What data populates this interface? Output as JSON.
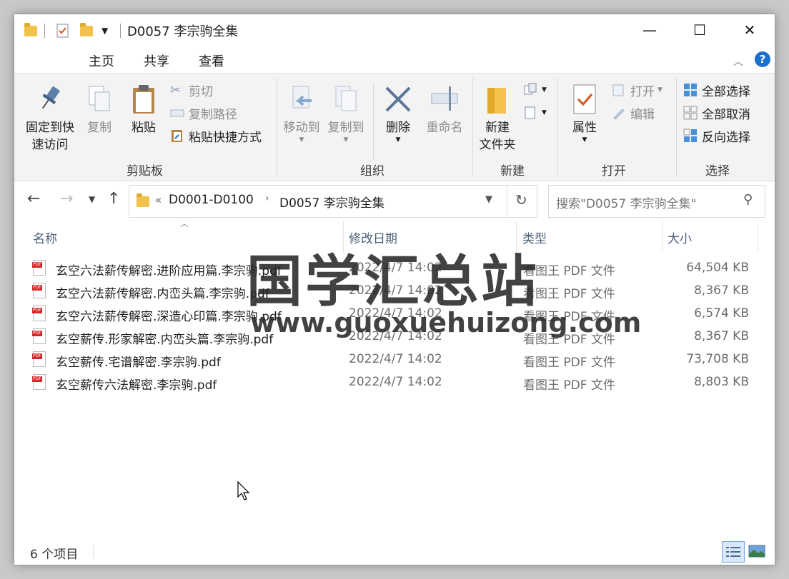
{
  "window": {
    "title": "D0057 李宗驹全集",
    "controls": {
      "minimize": "—",
      "maximize": "☐",
      "close": "✕"
    }
  },
  "tabs": [
    "主页",
    "共享",
    "查看"
  ],
  "ribbon": {
    "clipboard": {
      "pin_label_1": "固定到快",
      "pin_label_2": "速访问",
      "copy": "复制",
      "paste": "粘贴",
      "cut": "剪切",
      "copy_path": "复制路径",
      "paste_shortcut": "粘贴快捷方式",
      "group": "剪贴板"
    },
    "organize": {
      "move_to": "移动到",
      "copy_to": "复制到",
      "delete": "删除",
      "rename": "重命名",
      "group": "组织"
    },
    "new": {
      "new_folder_1": "新建",
      "new_folder_2": "文件夹",
      "group": "新建"
    },
    "open": {
      "properties": "属性",
      "open": "打开",
      "edit": "编辑",
      "group": "打开"
    },
    "select": {
      "select_all": "全部选择",
      "select_none": "全部取消",
      "invert": "反向选择",
      "group": "选择"
    }
  },
  "address": {
    "crumb_prefix": "«",
    "crumb1": "D0001-D0100",
    "crumb2": "D0057 李宗驹全集",
    "search_placeholder": "搜索\"D0057 李宗驹全集\""
  },
  "columns": {
    "name": "名称",
    "date": "修改日期",
    "type": "类型",
    "size": "大小"
  },
  "files": [
    {
      "name": "玄空六法薪传解密.进阶应用篇.李宗驹.pdf",
      "date": "2022/4/7 14:02",
      "type": "看图王 PDF 文件",
      "size": "64,504 KB"
    },
    {
      "name": "玄空六法薪传解密.内峦头篇.李宗驹.pdf",
      "date": "2022/4/7 14:02",
      "type": "看图王 PDF 文件",
      "size": "8,367 KB"
    },
    {
      "name": "玄空六法薪传解密.深造心印篇.李宗驹.pdf",
      "date": "2022/4/7 14:02",
      "type": "看图王 PDF 文件",
      "size": "6,574 KB"
    },
    {
      "name": "玄空薪传.形家解密.内峦头篇.李宗驹.pdf",
      "date": "2022/4/7 14:02",
      "type": "看图王 PDF 文件",
      "size": "8,367 KB"
    },
    {
      "name": "玄空薪传.宅谱解密.李宗驹.pdf",
      "date": "2022/4/7 14:02",
      "type": "看图王 PDF 文件",
      "size": "73,708 KB"
    },
    {
      "name": "玄空薪传六法解密.李宗驹.pdf",
      "date": "2022/4/7 14:02",
      "type": "看图王 PDF 文件",
      "size": "8,803 KB"
    }
  ],
  "watermark": {
    "line1": "国学汇总站",
    "line2": "www.guoxuehuizong.com"
  },
  "status": {
    "count": "6 个项目"
  },
  "colors": {
    "accent": "#1e6fc9",
    "folder": "#f2c24a",
    "header_text": "#4c607a"
  }
}
